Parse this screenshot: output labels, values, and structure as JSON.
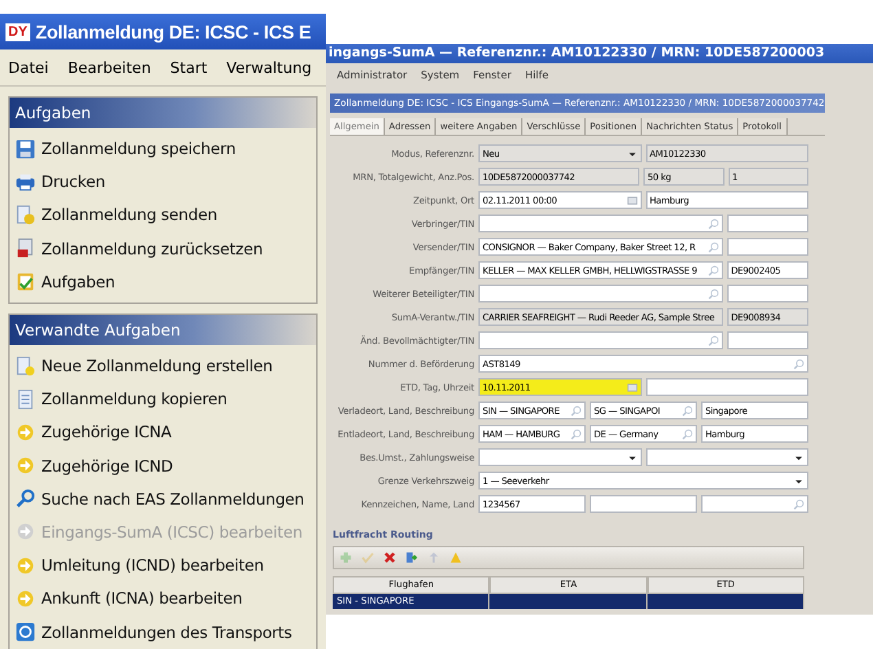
{
  "main_window": {
    "title": "Zollanmeldung DE: ICSC - ICS E",
    "logo": "DY",
    "menu": [
      "Datei",
      "Bearbeiten",
      "Start",
      "Verwaltung"
    ],
    "panels": [
      {
        "title": "Aufgaben",
        "items": [
          {
            "label": "Zollanmeldung speichern",
            "kind": "save",
            "disabled": false
          },
          {
            "label": "Drucken",
            "kind": "print",
            "disabled": false
          },
          {
            "label": "Zollanmeldung senden",
            "kind": "send",
            "disabled": false
          },
          {
            "label": "Zollanmeldung zurücksetzen",
            "kind": "reset",
            "disabled": false
          },
          {
            "label": "Aufgaben",
            "kind": "tasks",
            "disabled": false
          }
        ]
      },
      {
        "title": "Verwandte Aufgaben",
        "items": [
          {
            "label": "Neue Zollanmeldung erstellen",
            "kind": "new",
            "disabled": false
          },
          {
            "label": "Zollanmeldung kopieren",
            "kind": "copy",
            "disabled": false
          },
          {
            "label": "Zugehörige ICNA",
            "kind": "link",
            "disabled": false
          },
          {
            "label": "Zugehörige ICND",
            "kind": "link",
            "disabled": false
          },
          {
            "label": "Suche nach EAS Zollanmeldungen",
            "kind": "search",
            "disabled": false
          },
          {
            "label": "Eingangs-SumA (ICSC) bearbeiten",
            "kind": "link",
            "disabled": true
          },
          {
            "label": "Umleitung (ICND) bearbeiten",
            "kind": "link",
            "disabled": false
          },
          {
            "label": "Ankunft (ICNA) bearbeiten",
            "kind": "link",
            "disabled": false
          },
          {
            "label": "Zollanmeldungen des Transports",
            "kind": "transport",
            "disabled": false
          }
        ]
      }
    ]
  },
  "detail_window": {
    "title": "ingangs-SumA — Referenznr.: AM10122330 / MRN: 10DE587200003",
    "menu": [
      "Administrator",
      "System",
      "Fenster",
      "Hilfe"
    ],
    "document": {
      "title": "Zollanmeldung DE: ICSC - ICS Eingangs-SumA — Referenznr.: AM10122330 / MRN: 10DE5872000037742",
      "tabs": [
        {
          "label": "Allgemein",
          "selected": true
        },
        {
          "label": "Adressen",
          "selected": false
        },
        {
          "label": "weitere Angaben",
          "selected": false
        },
        {
          "label": "Verschlüsse",
          "selected": false
        },
        {
          "label": "Positionen",
          "selected": false
        },
        {
          "label": "Nachrichten Status",
          "selected": false
        },
        {
          "label": "Protokoll",
          "selected": false
        }
      ],
      "form": [
        {
          "label": "Modus, Referenznr.",
          "kind": "pair",
          "fields": [
            {
              "kind": "select",
              "value": "Neu",
              "readonly": true,
              "focused": false
            },
            {
              "kind": "text",
              "value": "AM10122330",
              "readonly": true,
              "focused": false
            }
          ]
        },
        {
          "label": "MRN, Totalgewicht, Anz.Pos.",
          "kind": "measure",
          "fields": [
            {
              "kind": "text",
              "value": "10DE5872000037742",
              "readonly": true,
              "focused": false
            },
            {
              "kind": "text",
              "value": "50 kg",
              "readonly": true,
              "focused": false
            },
            {
              "kind": "text",
              "value": "1",
              "readonly": true,
              "focused": false
            }
          ]
        },
        {
          "label": "Zeitpunkt, Ort",
          "kind": "pair",
          "fields": [
            {
              "kind": "date",
              "value": "02.11.2011 00:00",
              "readonly": false,
              "focused": false
            },
            {
              "kind": "text",
              "value": "Hamburg",
              "readonly": false,
              "focused": false
            }
          ]
        },
        {
          "label": "Verbringer/TIN",
          "kind": "party",
          "fields": [
            {
              "kind": "lookup",
              "readonly": false,
              "focused": false
            },
            {
              "kind": "text",
              "readonly": false,
              "focused": false
            }
          ]
        },
        {
          "label": "Versender/TIN",
          "kind": "party",
          "fields": [
            {
              "kind": "lookup",
              "value": "CONSIGNOR — Baker Company, Baker Street 12, R",
              "readonly": false,
              "focused": false
            },
            {
              "kind": "text",
              "readonly": false,
              "focused": false
            }
          ]
        },
        {
          "label": "Empfänger/TIN",
          "kind": "party",
          "fields": [
            {
              "kind": "lookup",
              "value": "KELLER — MAX KELLER GMBH, HELLWIGSTRASSE 9",
              "readonly": false,
              "focused": false
            },
            {
              "kind": "text",
              "value": "DE9002405",
              "readonly": false,
              "focused": false
            }
          ]
        },
        {
          "label": "Weiterer Beteiligter/TIN",
          "kind": "party",
          "fields": [
            {
              "kind": "lookup",
              "readonly": false,
              "focused": false
            },
            {
              "kind": "text",
              "readonly": false,
              "focused": false
            }
          ]
        },
        {
          "label": "SumA-Verantw./TIN",
          "kind": "party",
          "fields": [
            {
              "kind": "text",
              "value": "CARRIER SEAFREIGHT — Rudi Reeder AG, Sample Stree",
              "readonly": true,
              "focused": false
            },
            {
              "kind": "text",
              "value": "DE9008934",
              "readonly": true,
              "focused": false
            }
          ]
        },
        {
          "label": "Änd. Bevollmächtigter/TIN",
          "kind": "party",
          "fields": [
            {
              "kind": "lookup",
              "readonly": false,
              "focused": false
            },
            {
              "kind": "text",
              "readonly": false,
              "focused": false
            }
          ]
        },
        {
          "label": "Nummer d. Beförderung",
          "kind": "single",
          "fields": [
            {
              "kind": "lookup",
              "value": "AST8149",
              "readonly": false,
              "focused": false
            }
          ]
        },
        {
          "label": "ETD, Tag, Uhrzeit",
          "kind": "pair",
          "fields": [
            {
              "kind": "date",
              "value": "10.11.2011",
              "readonly": false,
              "focused": true
            },
            {
              "kind": "text",
              "readonly": false,
              "focused": false
            }
          ]
        },
        {
          "label": "Verladeort, Land, Beschreibung",
          "kind": "triple",
          "fields": [
            {
              "kind": "lookup",
              "value": "SIN — SINGAPORE",
              "readonly": false,
              "focused": false
            },
            {
              "kind": "lookup",
              "value": "SG — SINGAPOI",
              "readonly": false,
              "focused": false
            },
            {
              "kind": "text",
              "value": "Singapore",
              "readonly": false,
              "focused": false
            }
          ]
        },
        {
          "label": "Entladeort, Land, Beschreibung",
          "kind": "triple",
          "fields": [
            {
              "kind": "lookup",
              "value": "HAM — HAMBURG",
              "readonly": false,
              "focused": false
            },
            {
              "kind": "lookup",
              "value": "DE — Germany",
              "readonly": false,
              "focused": false
            },
            {
              "kind": "text",
              "value": "Hamburg",
              "readonly": false,
              "focused": false
            }
          ]
        },
        {
          "label": "Bes.Umst., Zahlungsweise",
          "kind": "pair",
          "fields": [
            {
              "kind": "select",
              "readonly": false,
              "focused": false
            },
            {
              "kind": "select",
              "readonly": false,
              "focused": false
            }
          ]
        },
        {
          "label": "Grenze Verkehrszweig",
          "kind": "single",
          "fields": [
            {
              "kind": "select",
              "value": "1 — Seeverkehr",
              "readonly": false,
              "focused": false
            }
          ]
        },
        {
          "label": "Kennzeichen, Name, Land",
          "kind": "triple",
          "fields": [
            {
              "kind": "text",
              "value": "1234567",
              "readonly": false,
              "focused": false
            },
            {
              "kind": "text",
              "readonly": false,
              "focused": false
            },
            {
              "kind": "lookup",
              "readonly": false,
              "focused": false
            }
          ]
        }
      ],
      "routing": {
        "title": "Luftfracht Routing",
        "toolbar": [
          {
            "kind": "add",
            "disabled": true
          },
          {
            "kind": "confirm",
            "disabled": true
          },
          {
            "kind": "delete",
            "disabled": false
          },
          {
            "kind": "export",
            "disabled": false
          },
          {
            "kind": "up",
            "disabled": true
          },
          {
            "kind": "warning",
            "disabled": false
          }
        ],
        "columns": [
          "Flughafen",
          "ETA",
          "ETD"
        ],
        "rows": [
          {
            "cells": [
              "SIN - SINGAPORE"
            ],
            "selected": true
          }
        ]
      }
    }
  }
}
